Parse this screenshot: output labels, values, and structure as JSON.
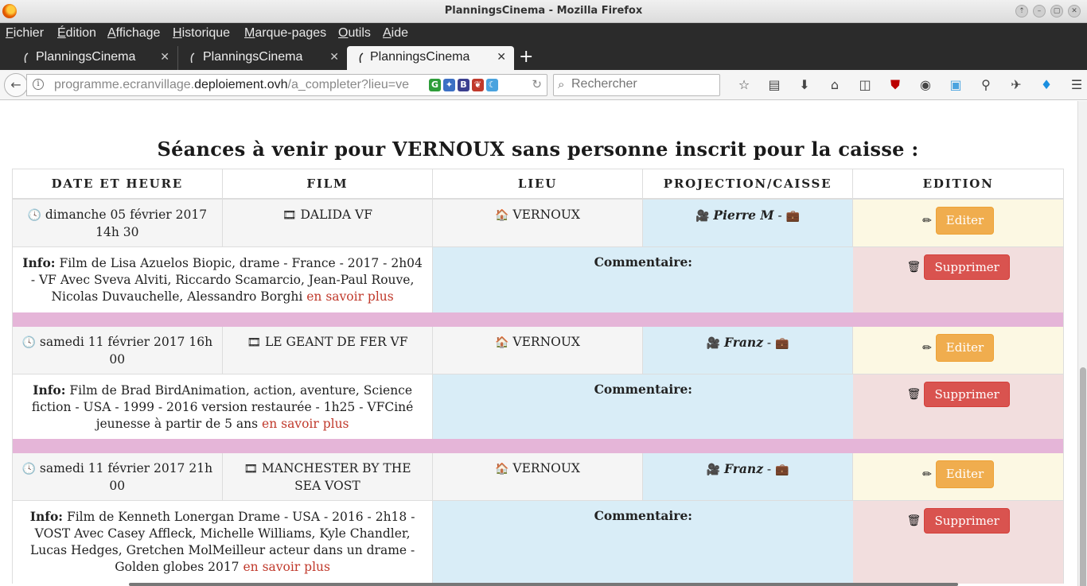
{
  "window": {
    "title": "PlanningsCinema - Mozilla Firefox",
    "buttons": [
      "⇡",
      "–",
      "▢",
      "✕"
    ]
  },
  "menu": [
    "Fichier",
    "Édition",
    "Affichage",
    "Historique",
    "Marque-pages",
    "Outils",
    "Aide"
  ],
  "tabs": [
    {
      "label": "PlanningsCinema"
    },
    {
      "label": "PlanningsCinema"
    },
    {
      "label": "PlanningsCinema"
    }
  ],
  "nav": {
    "url_prefix": "programme.ecranvillage.",
    "url_domain": "deploiement.ovh",
    "url_suffix": "/a_completer?lieu=ve",
    "search_placeholder": "Rechercher",
    "addons": [
      "G",
      "✦",
      "B",
      "❦",
      "☾"
    ]
  },
  "page": {
    "title": "Séances à venir pour VERNOUX sans personne inscrit pour la caisse :",
    "headers": [
      "DATE ET HEURE",
      "FILM",
      "LIEU",
      "PROJECTION/CAISSE",
      "EDITION"
    ],
    "info_label": "Info:",
    "comment_label": "Commentaire:",
    "more_label": "en savoir plus",
    "edit_label": "Editer",
    "delete_label": "Supprimer",
    "sessions": [
      {
        "date": "dimanche 05 février 2017 14h 30",
        "film": "DALIDA VF",
        "place": "VERNOUX",
        "projectionist": "Pierre M",
        "info": "Film de Lisa Azuelos Biopic, drame - France - 2017 - 2h04 - VF Avec Sveva Alviti, Riccardo Scamarcio, Jean-Paul Rouve, Nicolas Duvauchelle, Alessandro Borghi"
      },
      {
        "date": "samedi 11 février 2017 16h 00",
        "film": "LE GEANT DE FER VF",
        "place": "VERNOUX",
        "projectionist": "Franz",
        "info": "Film de Brad BirdAnimation, action, aventure, Science fiction - USA - 1999 - 2016 version restaurée - 1h25 - VFCiné jeunesse à partir de 5 ans"
      },
      {
        "date": "samedi 11 février 2017 21h 00",
        "film": "MANCHESTER BY THE SEA VOST",
        "place": "VERNOUX",
        "projectionist": "Franz",
        "info": "Film de Kenneth Lonergan Drame - USA - 2016 - 2h18 - VOST Avec Casey Affleck, Michelle Williams, Kyle Chandler, Lucas Hedges, Gretchen MolMeilleur acteur dans un drame - Golden globes 2017"
      }
    ]
  }
}
